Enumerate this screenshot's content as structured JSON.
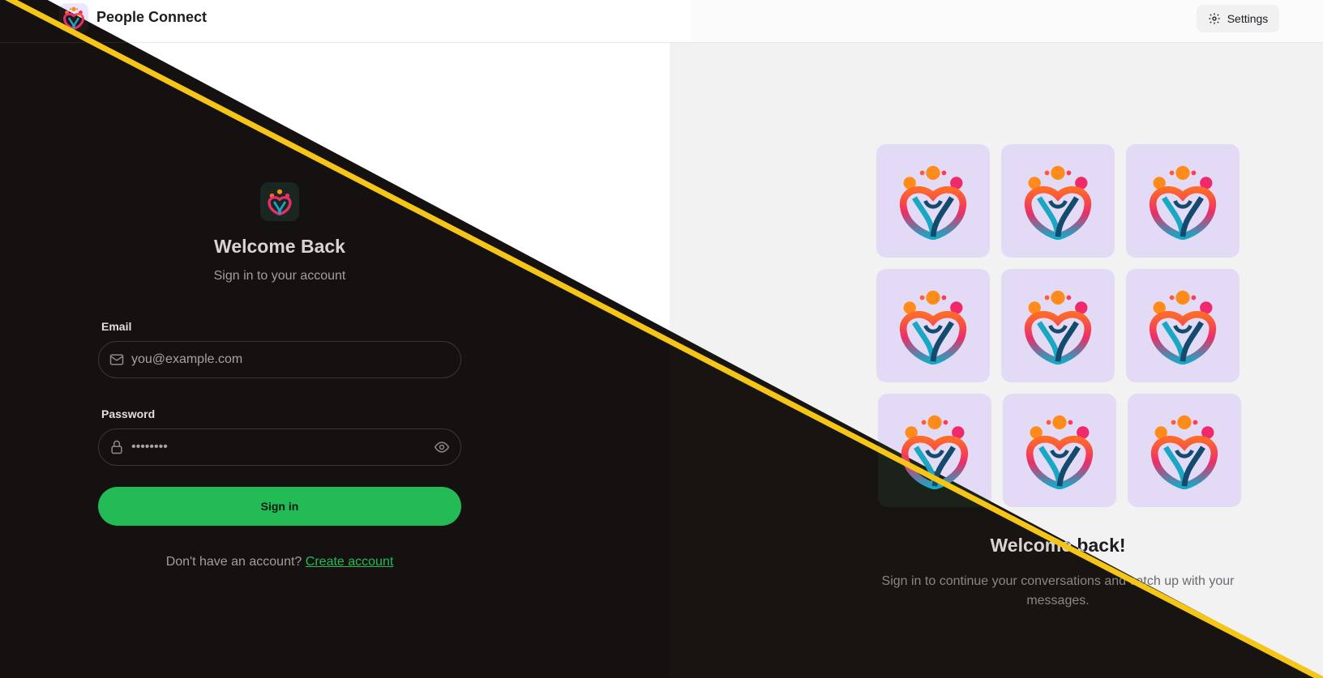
{
  "header": {
    "app_title": "People Connect",
    "settings_label": "Settings"
  },
  "login": {
    "title": "Welcome Back",
    "subtitle": "Sign in to your account",
    "email_label": "Email",
    "email_placeholder": "you@example.com",
    "password_label": "Password",
    "password_value": "••••••••",
    "signin_label": "Sign in",
    "no_account_text": "Don't have an account?",
    "create_account_label": "Create account"
  },
  "promo": {
    "title": "Welcome back!",
    "subtitle": "Sign in to continue your conversations and catch up with your messages.",
    "tile_count": 9
  },
  "colors": {
    "accent": "#22bb55",
    "divider": "#f5c518",
    "tile_bg": "#e3dbf5",
    "dark_bg": "#141110"
  },
  "icons": {
    "logo": "people-connect-logo-icon",
    "settings": "gear-icon",
    "email": "mail-icon",
    "password": "lock-icon",
    "visibility": "eye-icon"
  }
}
